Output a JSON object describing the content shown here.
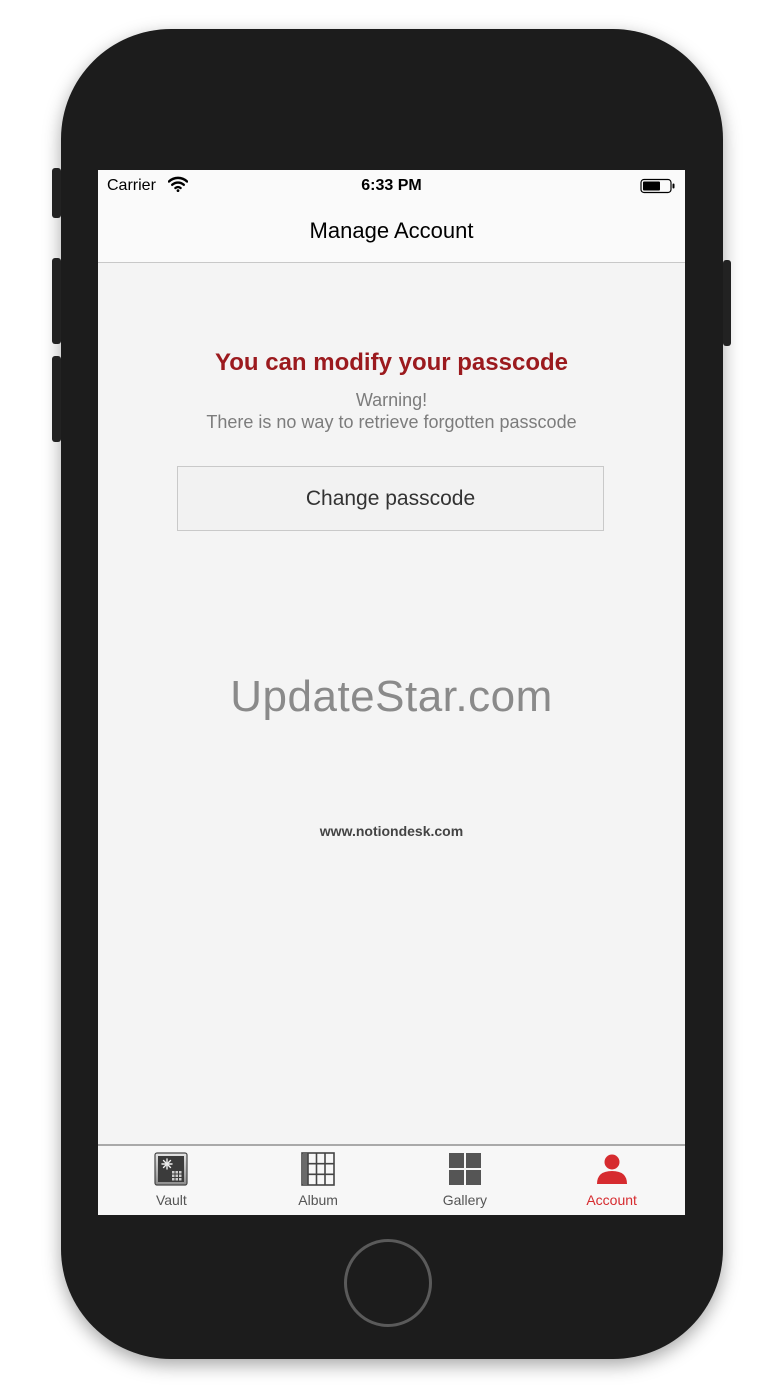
{
  "status_bar": {
    "carrier": "Carrier",
    "time": "6:33 PM"
  },
  "nav": {
    "title": "Manage Account"
  },
  "content": {
    "headline": "You can modify your passcode",
    "warning_title": "Warning!",
    "warning_text": "There is no way to retrieve forgotten passcode",
    "change_button_label": "Change passcode",
    "watermark": "UpdateStar.com",
    "website": "www.notiondesk.com"
  },
  "tabs": [
    {
      "label": "Vault",
      "icon": "vault-icon",
      "active": false
    },
    {
      "label": "Album",
      "icon": "album-icon",
      "active": false
    },
    {
      "label": "Gallery",
      "icon": "gallery-icon",
      "active": false
    },
    {
      "label": "Account",
      "icon": "account-icon",
      "active": true
    }
  ],
  "colors": {
    "accent": "#9b1a1e",
    "active_tab": "#d62b2f",
    "device": "#1c1c1c"
  }
}
